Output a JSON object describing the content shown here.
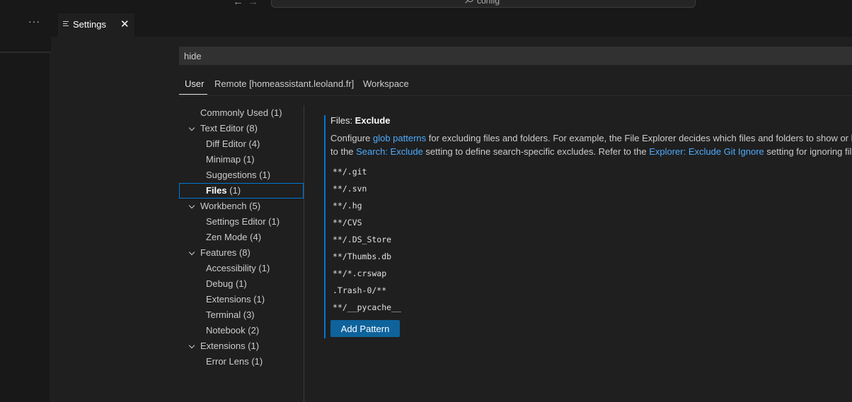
{
  "titlebar": {
    "command_center_text": "config",
    "back_arrow": "←",
    "forward_arrow": "→"
  },
  "sidebar": {
    "more_actions": "···"
  },
  "editor_tab": {
    "label": "Settings",
    "close_glyph": "✕"
  },
  "search": {
    "value": "hide"
  },
  "scope_tabs": [
    {
      "label": "User",
      "active": true
    },
    {
      "label": "Remote [homeassistant.leoland.fr]",
      "active": false
    },
    {
      "label": "Workspace",
      "active": false
    }
  ],
  "toc": [
    {
      "label": "Commonly Used",
      "count": "(1)",
      "expandable": false,
      "selected": false
    },
    {
      "label": "Text Editor",
      "count": "(8)",
      "expandable": true,
      "selected": false
    },
    {
      "label": "Diff Editor",
      "count": "(4)",
      "expandable": false,
      "selected": false
    },
    {
      "label": "Minimap",
      "count": "(1)",
      "expandable": false,
      "selected": false
    },
    {
      "label": "Suggestions",
      "count": "(1)",
      "expandable": false,
      "selected": false
    },
    {
      "label": "Files",
      "count": "(1)",
      "expandable": false,
      "selected": true
    },
    {
      "label": "Workbench",
      "count": "(5)",
      "expandable": true,
      "selected": false
    },
    {
      "label": "Settings Editor",
      "count": "(1)",
      "expandable": false,
      "selected": false
    },
    {
      "label": "Zen Mode",
      "count": "(4)",
      "expandable": false,
      "selected": false
    },
    {
      "label": "Features",
      "count": "(8)",
      "expandable": true,
      "selected": false
    },
    {
      "label": "Accessibility",
      "count": "(1)",
      "expandable": false,
      "selected": false
    },
    {
      "label": "Debug",
      "count": "(1)",
      "expandable": false,
      "selected": false
    },
    {
      "label": "Extensions",
      "count": "(1)",
      "expandable": false,
      "selected": false
    },
    {
      "label": "Terminal",
      "count": "(3)",
      "expandable": false,
      "selected": false
    },
    {
      "label": "Notebook",
      "count": "(2)",
      "expandable": false,
      "selected": false
    },
    {
      "label": "Extensions",
      "count": "(1)",
      "expandable": true,
      "selected": false
    },
    {
      "label": "Error Lens",
      "count": "(1)",
      "expandable": false,
      "selected": false
    }
  ],
  "setting": {
    "category": "Files: ",
    "name": "Exclude",
    "desc_line1": {
      "before": "Configure ",
      "link": "glob patterns",
      "after": " for excluding files and folders. For example, the File Explorer decides which files and folders to show or h"
    },
    "desc_line2": {
      "before": "to the ",
      "link1": "Search: Exclude",
      "middle": " setting to define search-specific excludes. Refer to the ",
      "link2": "Explorer: Exclude Git Ignore",
      "after": " setting for ignoring files"
    },
    "patterns": [
      "**/.git",
      "**/.svn",
      "**/.hg",
      "**/CVS",
      "**/.DS_Store",
      "**/Thumbs.db",
      "**/*.crswap",
      ".Trash-0/**",
      "**/__pycache__"
    ],
    "add_button": "Add Pattern"
  },
  "colors": {
    "accent": "#0078d4",
    "link": "#4daafc",
    "button": "#0e639c",
    "background": "#1f1f1f"
  }
}
